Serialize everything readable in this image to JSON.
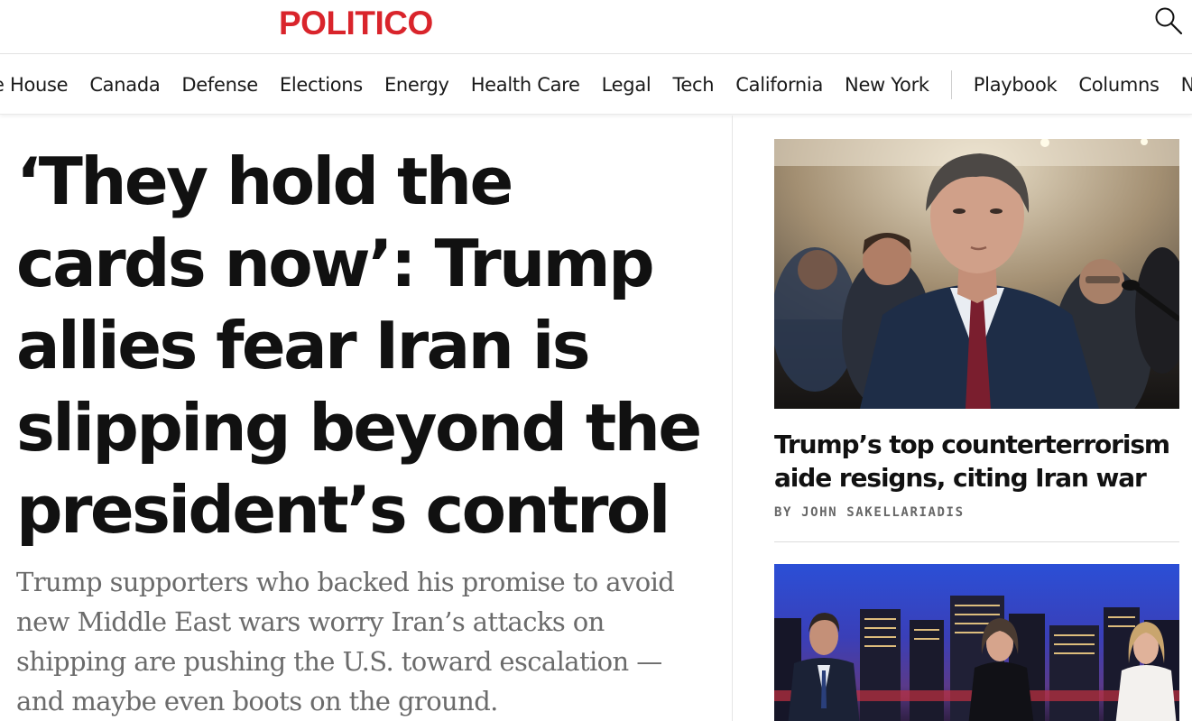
{
  "header": {
    "logo": "POLITICO",
    "brand_color": "#d9242b",
    "search_icon": "search-icon"
  },
  "nav": {
    "sections": [
      "e House",
      "Canada",
      "Defense",
      "Elections",
      "Energy",
      "Health Care",
      "Legal",
      "Tech",
      "California",
      "New York"
    ],
    "secondary": [
      "Playbook",
      "Columns",
      "Ne"
    ]
  },
  "lead": {
    "headline": "‘They hold the cards now’: Trump allies fear Iran is slipping beyond the president’s control",
    "dek": "Trump supporters who backed his promise to avoid new Middle East wars worry Iran’s attacks on shipping are pushing the U.S. toward escalation — and maybe even boots on the ground."
  },
  "sidebar": {
    "story1": {
      "title": "Trump’s top counterterrorism aide resigns, citing Iran war",
      "byline_prefix": "BY",
      "author": "JOHN SAKELLARIADIS"
    }
  }
}
